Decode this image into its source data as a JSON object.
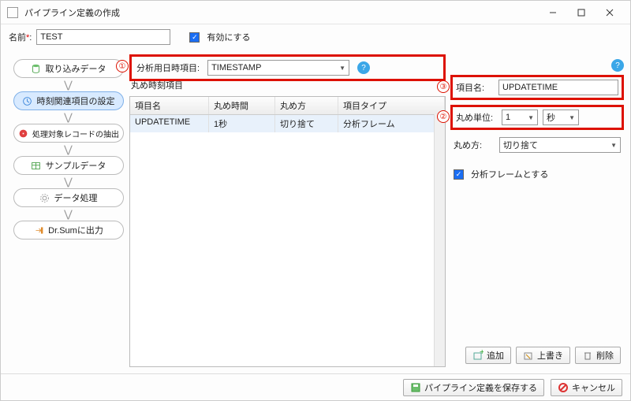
{
  "window": {
    "title": "パイプライン定義の作成"
  },
  "form": {
    "name_label": "名前",
    "name_value": "TEST",
    "enable_label": "有効にする",
    "enable_checked": true
  },
  "steps": [
    {
      "id": "import",
      "label": "取り込みデータ"
    },
    {
      "id": "time",
      "label": "時刻関連項目の設定",
      "active": true
    },
    {
      "id": "filter",
      "label": "処理対象レコードの抽出"
    },
    {
      "id": "sample",
      "label": "サンプルデータ"
    },
    {
      "id": "process",
      "label": "データ処理"
    },
    {
      "id": "output",
      "label": "Dr.Sumに出力"
    }
  ],
  "analysis": {
    "label": "分析用日時項目:",
    "value": "TIMESTAMP",
    "section_label": "丸め時刻項目"
  },
  "table": {
    "headers": [
      "項目名",
      "丸め時間",
      "丸め方",
      "項目タイプ"
    ],
    "rows": [
      {
        "name": "UPDATETIME",
        "round": "1秒",
        "method": "切り捨て",
        "type": "分析フレーム"
      }
    ]
  },
  "detail": {
    "name_label": "項目名:",
    "name_value": "UPDATETIME",
    "unit_label": "丸め単位:",
    "unit_num": "1",
    "unit_unit": "秒",
    "method_label": "丸め方:",
    "method_value": "切り捨て",
    "frame_label": "分析フレームとする"
  },
  "annotations": {
    "a1": "①",
    "a2": "②",
    "a3": "③"
  },
  "buttons": {
    "add": "追加",
    "overwrite": "上書き",
    "delete": "削除",
    "save": "パイプライン定義を保存する",
    "cancel": "キャンセル"
  }
}
